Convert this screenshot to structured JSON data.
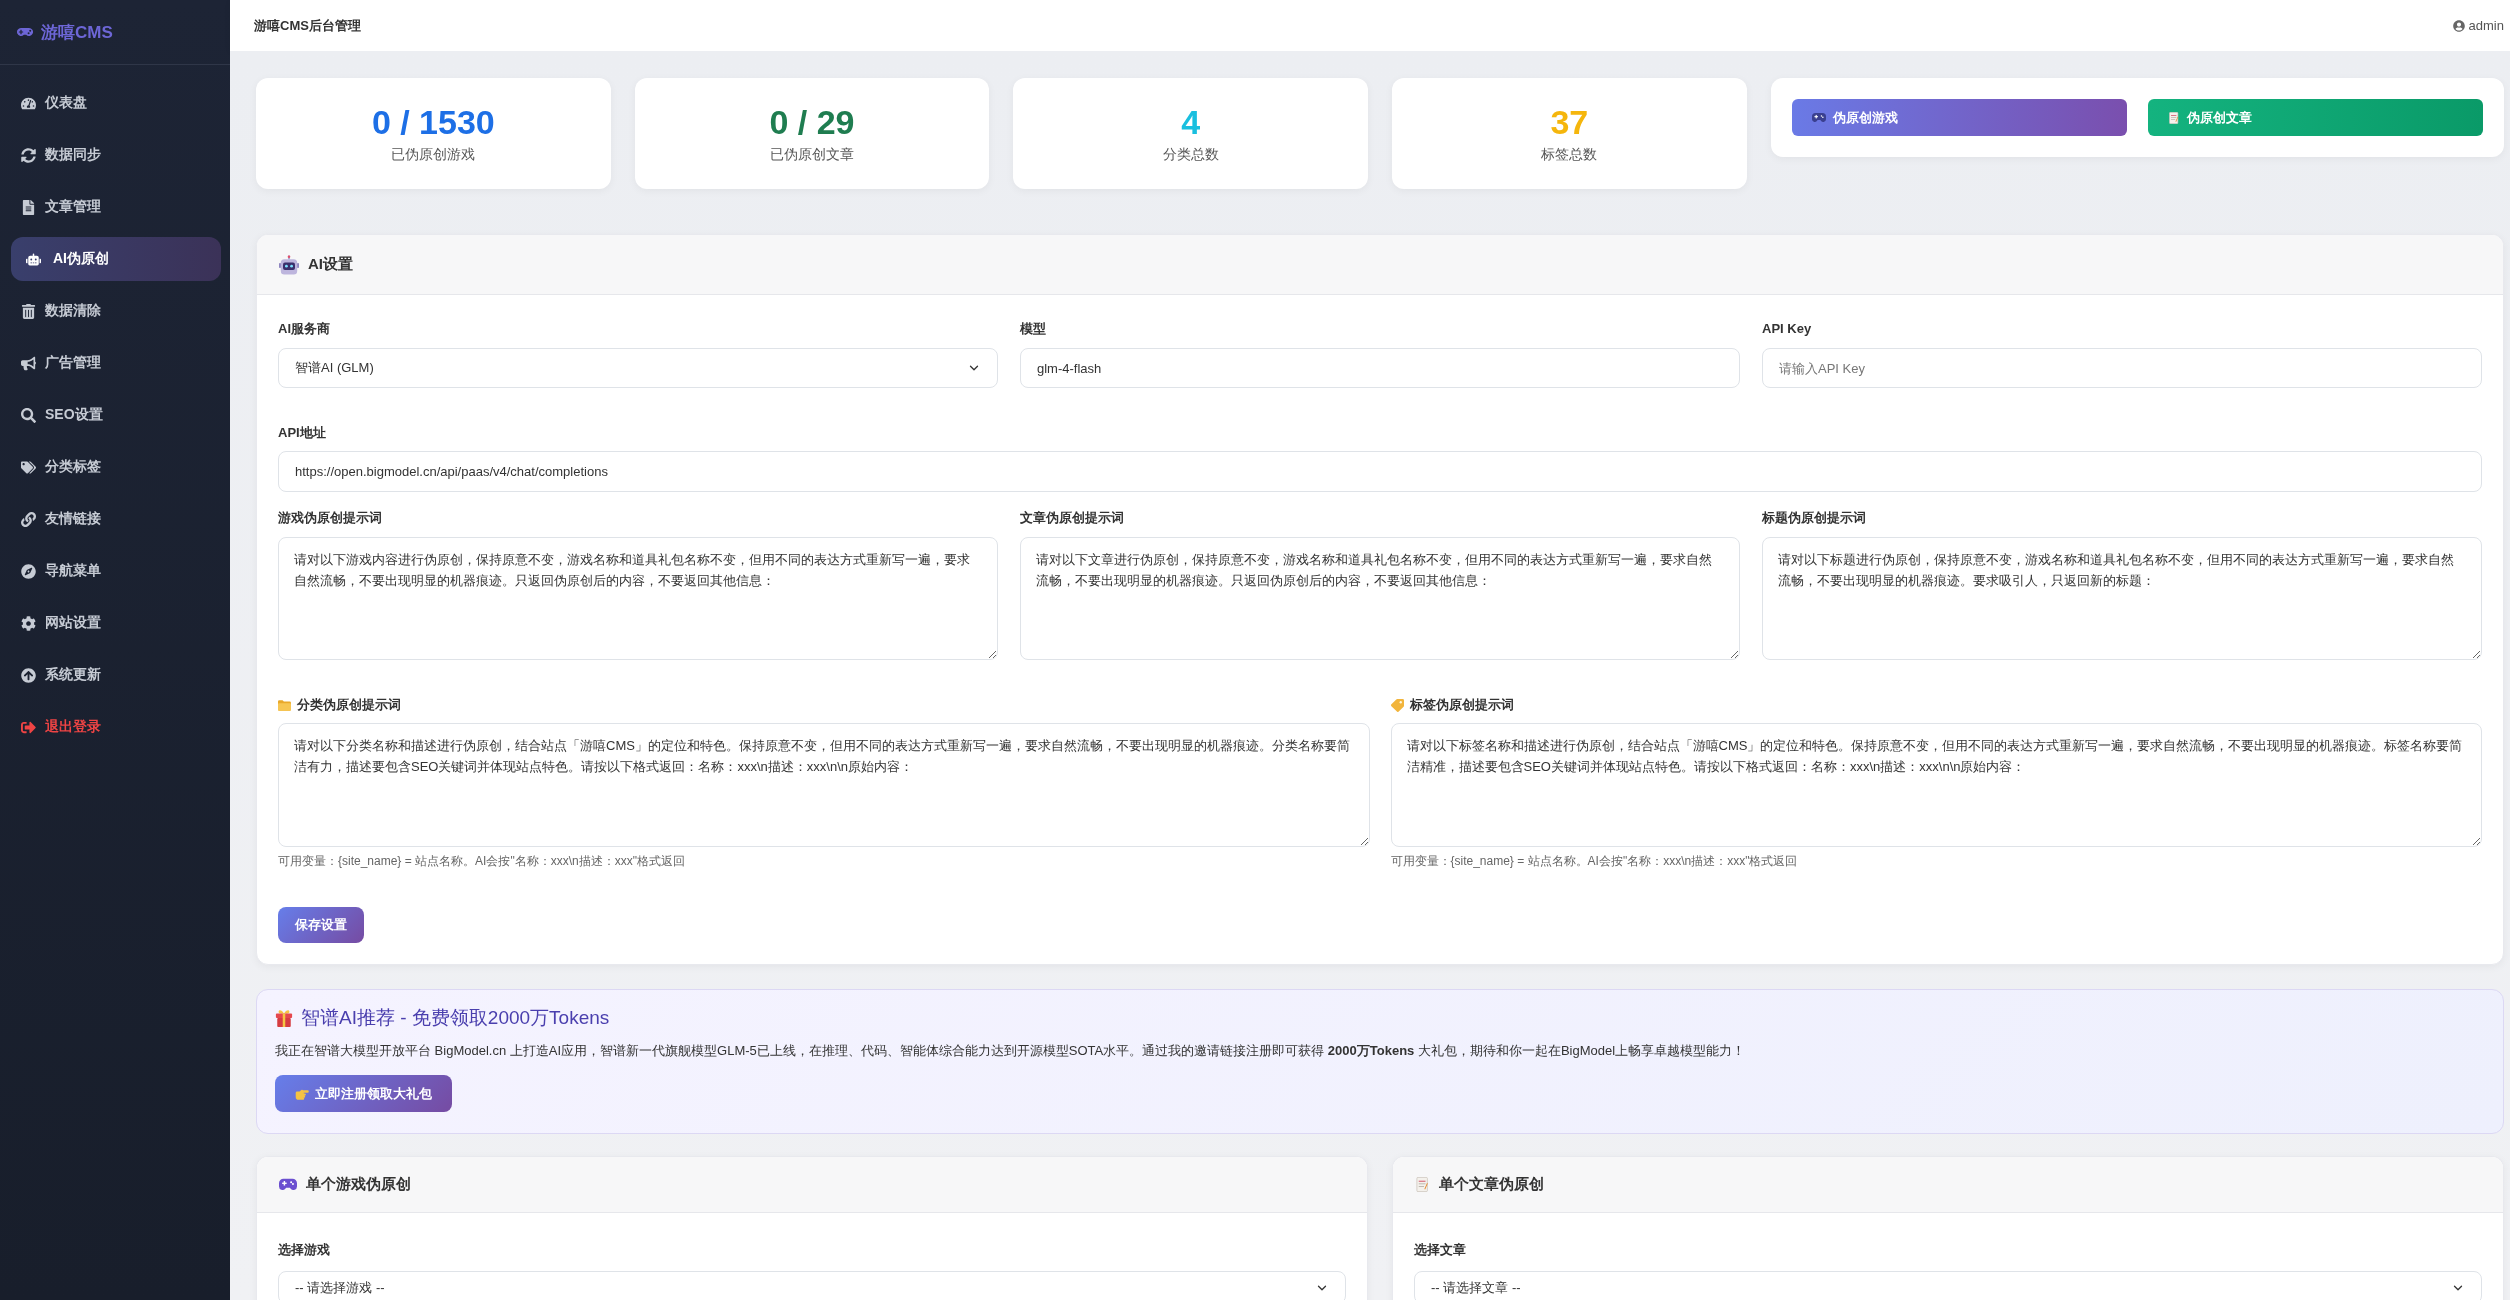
{
  "sidebar": {
    "logo": "游嘻CMS",
    "items": [
      {
        "label": "仪表盘",
        "selected": false,
        "kind": "nav"
      },
      {
        "label": "数据同步",
        "selected": false,
        "kind": "nav"
      },
      {
        "label": "文章管理",
        "selected": false,
        "kind": "nav"
      },
      {
        "label": "AI伪原创",
        "selected": true,
        "kind": "nav"
      },
      {
        "label": "数据清除",
        "selected": false,
        "kind": "nav"
      },
      {
        "label": "广告管理",
        "selected": false,
        "kind": "nav"
      },
      {
        "label": "SEO设置",
        "selected": false,
        "kind": "nav"
      },
      {
        "label": "分类标签",
        "selected": false,
        "kind": "nav"
      },
      {
        "label": "友情链接",
        "selected": false,
        "kind": "nav"
      },
      {
        "label": "导航菜单",
        "selected": false,
        "kind": "nav"
      },
      {
        "label": "网站设置",
        "selected": false,
        "kind": "nav"
      },
      {
        "label": "系统更新",
        "selected": false,
        "kind": "nav"
      },
      {
        "label": "退出登录",
        "selected": false,
        "kind": "logout"
      }
    ]
  },
  "topbar": {
    "title": "游嘻CMS后台管理",
    "user": "admin"
  },
  "stats": [
    {
      "value": "0 / 1530",
      "label": "已伪原创游戏",
      "color": "#1d6fe6"
    },
    {
      "value": "0 / 29",
      "label": "已伪原创文章",
      "color": "#1f7d50"
    },
    {
      "value": "4",
      "label": "分类总数",
      "color": "#19bfdf"
    },
    {
      "value": "37",
      "label": "标签总数",
      "color": "#f5b60c"
    }
  ],
  "actions": [
    {
      "label": "伪原创游戏",
      "kind": "primary"
    },
    {
      "label": "伪原创文章",
      "kind": "success"
    }
  ],
  "ai_settings": {
    "title": "AI设置",
    "provider": {
      "label": "AI服务商",
      "value": "智谱AI (GLM)"
    },
    "model": {
      "label": "模型",
      "value": "glm-4-flash"
    },
    "api_key": {
      "label": "API Key",
      "placeholder": "请输入API Key"
    },
    "api_url": {
      "label": "API地址",
      "value": "https://open.bigmodel.cn/api/paas/v4/chat/completions"
    },
    "prompts": [
      {
        "label": "游戏伪原创提示词",
        "value": "请对以下游戏内容进行伪原创，保持原意不变，游戏名称和道具礼包名称不变，但用不同的表达方式重新写一遍，要求自然流畅，不要出现明显的机器痕迹。只返回伪原创后的内容，不要返回其他信息："
      },
      {
        "label": "文章伪原创提示词",
        "value": "请对以下文章进行伪原创，保持原意不变，游戏名称和道具礼包名称不变，但用不同的表达方式重新写一遍，要求自然流畅，不要出现明显的机器痕迹。只返回伪原创后的内容，不要返回其他信息："
      },
      {
        "label": "标题伪原创提示词",
        "value": "请对以下标题进行伪原创，保持原意不变，游戏名称和道具礼包名称不变，但用不同的表达方式重新写一遍，要求自然流畅，不要出现明显的机器痕迹。要求吸引人，只返回新的标题："
      }
    ],
    "meta_prompts": [
      {
        "label": "分类伪原创提示词",
        "value": "请对以下分类名称和描述进行伪原创，结合站点「游嘻CMS」的定位和特色。保持原意不变，但用不同的表达方式重新写一遍，要求自然流畅，不要出现明显的机器痕迹。分类名称要简洁有力，描述要包含SEO关键词并体现站点特色。请按以下格式返回：名称：xxx\\n描述：xxx\\n\\n原始内容：",
        "hint": "可用变量：{site_name} = 站点名称。AI会按\"名称：xxx\\n描述：xxx\"格式返回"
      },
      {
        "label": "标签伪原创提示词",
        "value": "请对以下标签名称和描述进行伪原创，结合站点「游嘻CMS」的定位和特色。保持原意不变，但用不同的表达方式重新写一遍，要求自然流畅，不要出现明显的机器痕迹。标签名称要简洁精准，描述要包含SEO关键词并体现站点特色。请按以下格式返回：名称：xxx\\n描述：xxx\\n\\n原始内容：",
        "hint": "可用变量：{site_name} = 站点名称。AI会按\"名称：xxx\\n描述：xxx\"格式返回"
      }
    ],
    "save_button": "保存设置"
  },
  "promo": {
    "title": "智谱AI推荐 - 免费领取2000万Tokens",
    "text": "我正在智谱大模型开放平台 BigModel.cn 上打造AI应用，智谱新一代旗舰模型GLM-5已上线，在推理、代码、智能体综合能力达到开源模型SOTA水平。通过我的邀请链接注册即可获得 **2000万Tokens** 大礼包，期待和你一起在BigModel上畅享卓越模型能力！",
    "button": "立即注册领取大礼包"
  },
  "single_tools": [
    {
      "title": "单个游戏伪原创",
      "field_label": "选择游戏",
      "select_value": "-- 请选择游戏 --"
    },
    {
      "title": "单个文章伪原创",
      "field_label": "选择文章",
      "select_value": "-- 请选择文章 --"
    }
  ]
}
